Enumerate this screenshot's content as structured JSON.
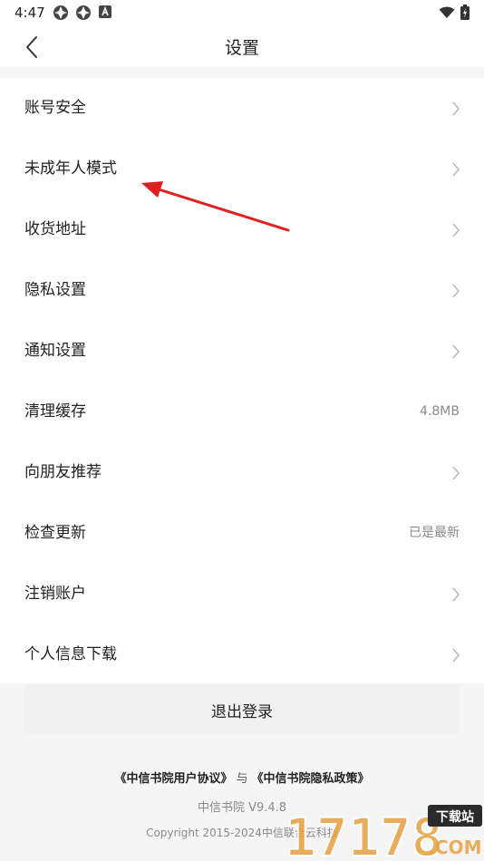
{
  "status_bar": {
    "time": "4:47"
  },
  "header": {
    "title": "设置"
  },
  "settings": [
    {
      "label": "账号安全",
      "value": "",
      "chevron": true
    },
    {
      "label": "未成年人模式",
      "value": "",
      "chevron": true
    },
    {
      "label": "收货地址",
      "value": "",
      "chevron": true
    },
    {
      "label": "隐私设置",
      "value": "",
      "chevron": true
    },
    {
      "label": "通知设置",
      "value": "",
      "chevron": true
    },
    {
      "label": "清理缓存",
      "value": "4.8MB",
      "chevron": false
    },
    {
      "label": "向朋友推荐",
      "value": "",
      "chevron": true
    },
    {
      "label": "检查更新",
      "value": "已是最新",
      "chevron": false
    },
    {
      "label": "注销账户",
      "value": "",
      "chevron": true
    },
    {
      "label": "个人信息下载",
      "value": "",
      "chevron": true
    }
  ],
  "logout": {
    "label": "退出登录"
  },
  "footer": {
    "user_agreement": "《中信书院用户协议》",
    "separator": "与",
    "privacy_policy": "《中信书院隐私政策》",
    "version": "中信书院 V9.4.8",
    "copyright": "Copyright 2015-2024中信联合云科技"
  },
  "watermark": {
    "text": "17178",
    "badge": "下载站",
    "suffix": ".COM"
  },
  "colors": {
    "annotation_arrow": "#e02020",
    "text_primary": "#222222",
    "text_secondary": "#8a8a8a"
  }
}
